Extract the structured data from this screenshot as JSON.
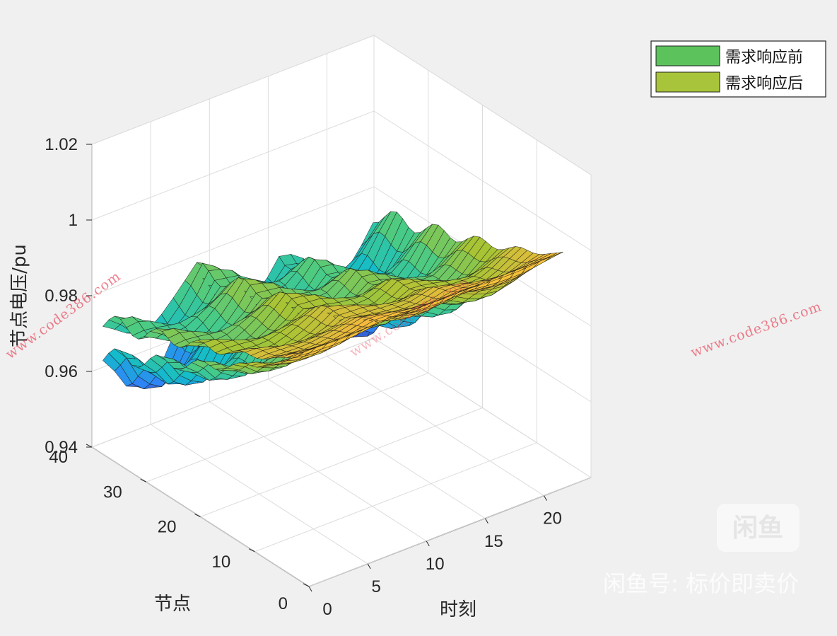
{
  "chart_data": {
    "type": "surface3d",
    "title": "",
    "xlabel": "时刻",
    "ylabel": "节点",
    "zlabel": "节点电压/pu",
    "xlim": [
      0,
      24
    ],
    "ylim": [
      0,
      40
    ],
    "zlim": [
      0.94,
      1.02
    ],
    "x_ticks": [
      "0",
      "5",
      "10",
      "15",
      "20"
    ],
    "y_ticks": [
      "0",
      "10",
      "20",
      "30",
      "40"
    ],
    "z_ticks": [
      "0.94",
      "0.96",
      "0.98",
      "1",
      "1.02"
    ],
    "grid": true,
    "legend_position": "top-right",
    "legend": [
      {
        "label": "需求响应前",
        "color": "#5cc35c"
      },
      {
        "label": "需求响应后",
        "color": "#a8c43a"
      }
    ],
    "series": [
      {
        "name": "需求响应前",
        "description_of_shape": "node voltage surface over 24 hours and 33 nodes; dips around hours 3-6, 12-14 and 20-22 at far nodes, near 1.0 at node 1",
        "hour_profile_min_voltage": [
          0.966,
          0.963,
          0.958,
          0.956,
          0.955,
          0.957,
          0.962,
          0.968,
          0.975,
          0.972,
          0.967,
          0.962,
          0.958,
          0.957,
          0.96,
          0.966,
          0.963,
          0.957,
          0.952,
          0.949,
          0.948,
          0.952,
          0.96,
          0.968
        ]
      },
      {
        "name": "需求响应后",
        "description_of_shape": "node voltage surface after demand response, flatter with higher minimum voltage",
        "hour_profile_min_voltage": [
          0.975,
          0.974,
          0.972,
          0.97,
          0.969,
          0.97,
          0.972,
          0.975,
          0.979,
          0.977,
          0.975,
          0.972,
          0.97,
          0.969,
          0.971,
          0.974,
          0.972,
          0.969,
          0.966,
          0.964,
          0.963,
          0.966,
          0.971,
          0.976
        ]
      }
    ]
  },
  "watermarks": {
    "site_left": "www.code386.com",
    "site_right": "www.code386.com",
    "site_center": "www.code386.com",
    "brand_logo": "闲鱼",
    "brand_text": "闲鱼号: 标价即卖价"
  },
  "colors": {
    "background": "#f0f0f0",
    "axes_bg": "#ffffff",
    "grid": "#dcdcdc",
    "colormap": [
      "#3e26a8",
      "#2e87f7",
      "#13bcca",
      "#48cb86",
      "#a6c435",
      "#f5ba3d",
      "#f9fb15"
    ]
  }
}
